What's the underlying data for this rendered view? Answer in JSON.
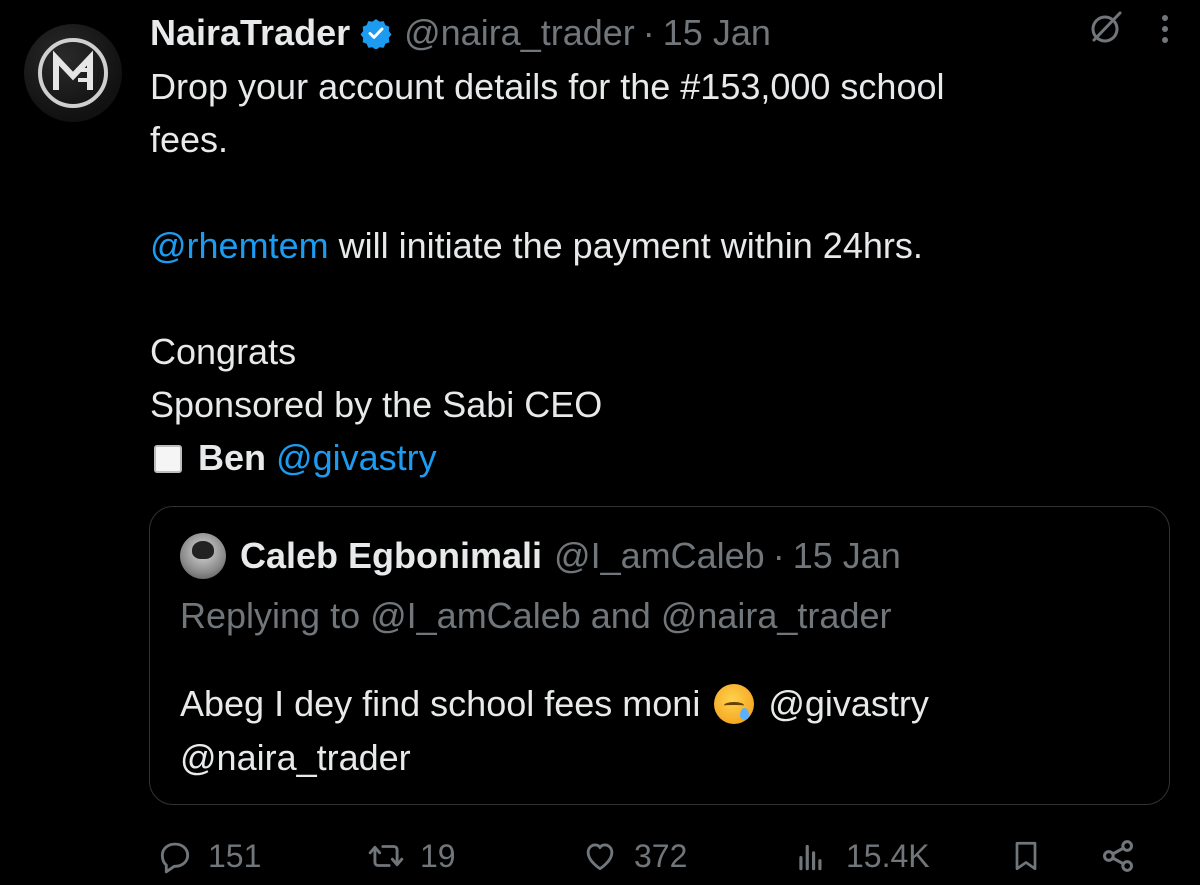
{
  "tweet": {
    "author": {
      "name": "NairaTrader",
      "handle": "@naira_trader",
      "date": "15 Jan",
      "separator": "·",
      "verified": true
    },
    "text_lines": {
      "line1": "Drop your account details for the #153,000 school",
      "line2": "fees.",
      "mention": "@rhemtem",
      "line3_rest": " will initiate the payment within 24hrs.",
      "congrats": "Congrats",
      "sponsored": "Sponsored by the Sabi CEO",
      "ben": "Ben",
      "ben_handle": "@givastry"
    }
  },
  "quote": {
    "name": "Caleb Egbonimali",
    "handle": "@I_amCaleb",
    "separator": "·",
    "date": "15 Jan",
    "replying_to": "Replying to @I_amCaleb and @naira_trader",
    "body_part1": "Abeg I dey find school fees moni",
    "body_mention1": "@givastry",
    "body_mention2": "@naira_trader",
    "emoji_name": "sleepy-face-emoji"
  },
  "actions": {
    "replies": "151",
    "retweets": "19",
    "likes": "372",
    "views": "15.4K"
  },
  "colors": {
    "background": "#000000",
    "text": "#e7e9ea",
    "muted": "#71767b",
    "link": "#1d9bf0",
    "verified": "#1d9bf0",
    "border": "#2f3336"
  },
  "icons": {
    "avatar_logo": "naira-trader-logo",
    "verified": "verified-badge-icon",
    "grok": "grok-icon",
    "more": "more-vertical-icon",
    "reply": "reply-icon",
    "retweet": "retweet-icon",
    "like": "heart-icon",
    "views": "views-icon",
    "bookmark": "bookmark-icon",
    "share": "share-icon"
  }
}
